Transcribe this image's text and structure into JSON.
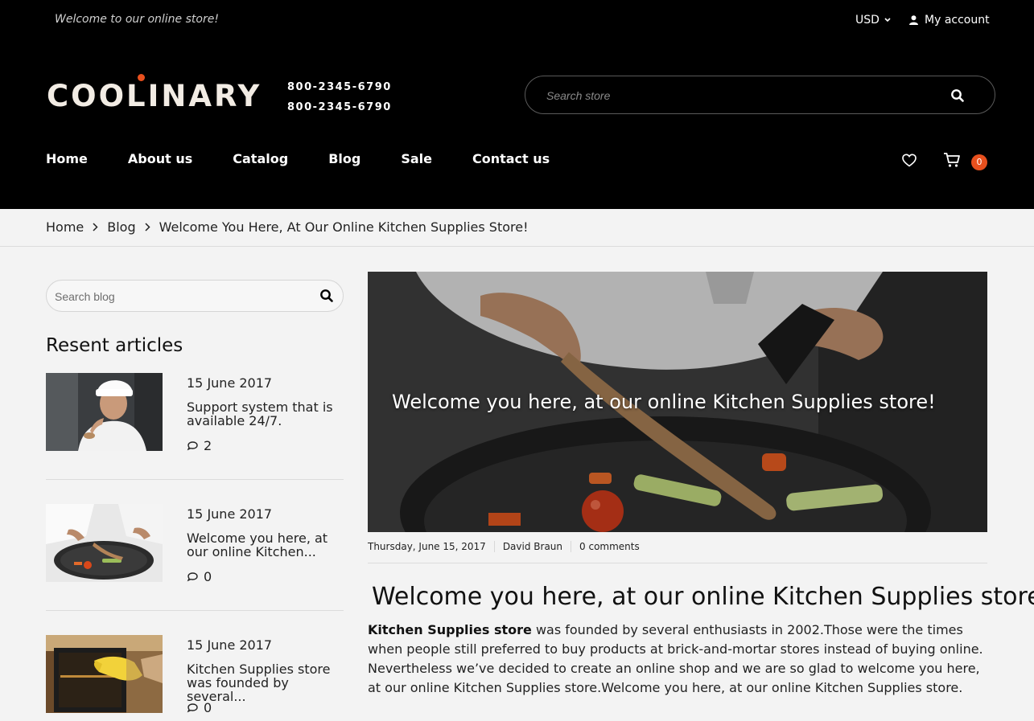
{
  "topbar": {
    "welcome": "Welcome to our online store!",
    "currency": "USD",
    "account": "My account"
  },
  "brand": {
    "logo": "COOLINARY",
    "accent": "#e8501e"
  },
  "phones": [
    "800-2345-6790",
    "800-2345-6790"
  ],
  "search": {
    "placeholder": "Search store"
  },
  "nav": [
    "Home",
    "About us",
    "Catalog",
    "Blog",
    "Sale",
    "Contact us"
  ],
  "cart": {
    "count": "0"
  },
  "breadcrumb": [
    "Home",
    "Blog",
    "Welcome You Here, At Our Online Kitchen Supplies Store!"
  ],
  "sidebar": {
    "search_placeholder": "Search blog",
    "title": "Resent articles",
    "articles": [
      {
        "date": "15 June 2017",
        "title": "Support system that is available 24/7.",
        "comments": "2"
      },
      {
        "date": "15 June 2017",
        "title": "Welcome you here, at our online Kitchen...",
        "comments": "0"
      },
      {
        "date": "15 June 2017",
        "title": "Kitchen Supplies store was founded by several...",
        "comments": "0"
      }
    ]
  },
  "post": {
    "hero_title": "Welcome you here, at our online Kitchen Supplies store!",
    "date": "Thursday, June 15, 2017",
    "author": "David Braun",
    "comments": "0 comments",
    "title": "Welcome you here, at our online Kitchen Supplies store!",
    "body_lead": "Kitchen Supplies store",
    "body_rest": " was founded by several enthusiasts in 2002.Those were the times when people still preferred to buy products at brick-and-mortar stores instead of buying online. Nevertheless we’ve decided to create an online shop and we are so glad to welcome you here, at our online Kitchen Supplies store.Welcome you here, at our online Kitchen Supplies store."
  }
}
